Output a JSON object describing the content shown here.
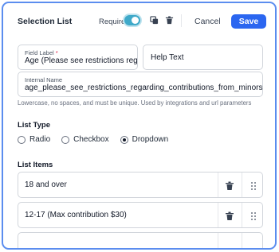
{
  "header": {
    "title": "Selection List",
    "required_label": "Required",
    "required_on": true,
    "cancel_label": "Cancel",
    "save_label": "Save"
  },
  "fields": {
    "field_label": {
      "label": "Field Label",
      "required_marker": "*",
      "value": "Age (Please see restrictions regar"
    },
    "help_text": {
      "placeholder": "Help Text"
    },
    "internal_name": {
      "label": "Internal Name",
      "value": "age_please_see_restrictions_regarding_contributions_from_minors_"
    },
    "hint": "Lowercase, no spaces, and must be unique. Used by integrations and url parameters"
  },
  "list_type": {
    "title": "List Type",
    "options": [
      {
        "label": "Radio",
        "checked": false
      },
      {
        "label": "Checkbox",
        "checked": false
      },
      {
        "label": "Dropdown",
        "checked": true
      }
    ]
  },
  "list_items": {
    "title": "List Items",
    "items": [
      {
        "label": "18 and over"
      },
      {
        "label": "12-17 (Max contribution $30)"
      },
      {
        "label": ""
      }
    ]
  },
  "colors": {
    "accent": "#2b66f0",
    "frame_border": "#5b8def",
    "toggle_on": "#3fa9c9"
  }
}
